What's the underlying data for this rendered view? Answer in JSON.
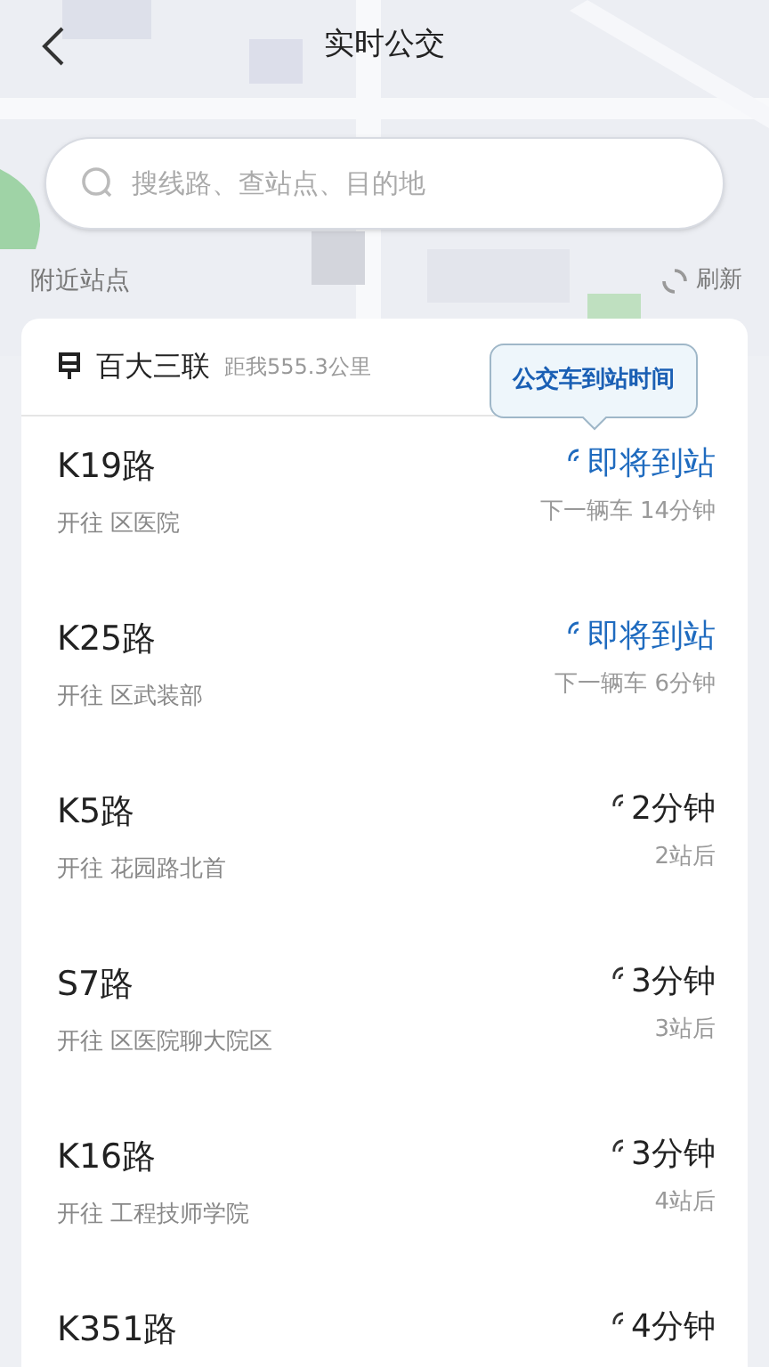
{
  "header": {
    "title": "实时公交"
  },
  "search": {
    "placeholder": "搜线路、查站点、目的地"
  },
  "nearby": {
    "label": "附近站点",
    "refresh": "刷新"
  },
  "station": {
    "name": "百大三联",
    "distance": "距我555.3公里",
    "tooltip": "公交车到站时间"
  },
  "routes": [
    {
      "name": "K19路",
      "destination": "开往 区医院",
      "kind": "arriving",
      "status": "即将到站",
      "detail": "下一辆车 14分钟"
    },
    {
      "name": "K25路",
      "destination": "开往 区武装部",
      "kind": "arriving",
      "status": "即将到站",
      "detail": "下一辆车 6分钟"
    },
    {
      "name": "K5路",
      "destination": "开往 花园路北首",
      "kind": "countdown",
      "status": "2分钟",
      "detail": "2站后"
    },
    {
      "name": "S7路",
      "destination": "开往 区医院聊大院区",
      "kind": "countdown",
      "status": "3分钟",
      "detail": "3站后"
    },
    {
      "name": "K16路",
      "destination": "开往 工程技师学院",
      "kind": "countdown",
      "status": "3分钟",
      "detail": "4站后"
    },
    {
      "name": "K351路",
      "kind": "countdown",
      "status": "4分钟"
    }
  ]
}
